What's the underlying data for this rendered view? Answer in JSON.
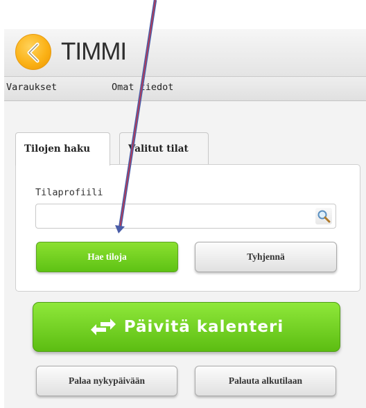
{
  "app": {
    "title": "TIMMI"
  },
  "nav": {
    "items": [
      {
        "label": "Varaukset"
      },
      {
        "label": "Omat tiedot"
      }
    ]
  },
  "tabs": [
    {
      "label": "Tilojen haku",
      "active": true
    },
    {
      "label": "Valitut tilat",
      "active": false
    }
  ],
  "search": {
    "label": "Tilaprofiili",
    "value": "",
    "placeholder": ""
  },
  "buttons": {
    "search": "Hae tiloja",
    "clear": "Tyhjennä",
    "refresh": "Päivitä kalenteri",
    "today": "Palaa nykypäivään",
    "reset": "Palauta alkutilaan"
  },
  "colors": {
    "accent_green": "#6ad21c",
    "logo_orange": "#fbb217",
    "annotation_arrow": "#4a5da8"
  },
  "icons": {
    "logo": "clock-back-icon",
    "search": "magnifier-icon",
    "refresh": "swap-arrows-icon"
  }
}
